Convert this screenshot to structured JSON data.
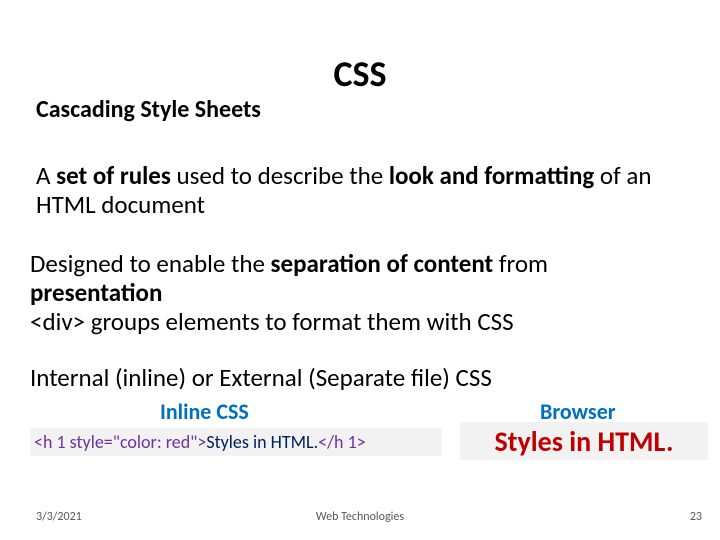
{
  "title": "CSS",
  "subtitle": "Cascading Style Sheets",
  "para1": {
    "t1": "A ",
    "b1": "set of rules",
    "t2": " used to describe the ",
    "b2": "look and formatting",
    "t3": " of an HTML document"
  },
  "para2": {
    "t1": "Designed  to enable the ",
    "b1": "separation of content",
    "t2": " from ",
    "b2": "presentation",
    "t3": "",
    "line2": "<div> groups elements to format them with CSS"
  },
  "para3": "Internal (inline) or External (Separate file) CSS",
  "col_inline": "Inline CSS",
  "col_browser": "Browser",
  "code": {
    "p1": "<h 1 style=\"color: red\">",
    "p2": "  Styles in HTML. ",
    "p3": "</h 1>"
  },
  "result": "Styles in HTML.",
  "footer": {
    "date": "3/3/2021",
    "center": "Web Technologies",
    "page": "23"
  }
}
